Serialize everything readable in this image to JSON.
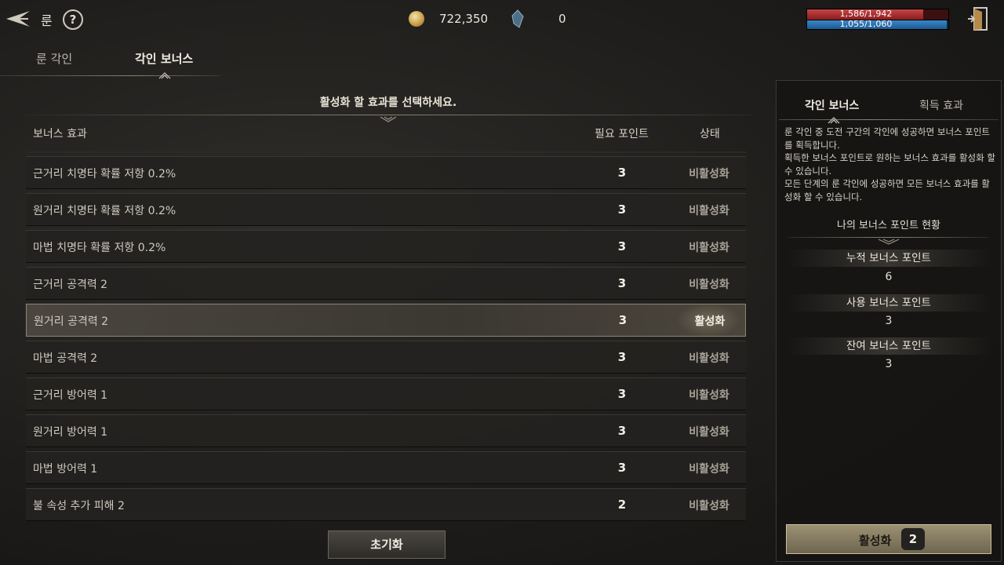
{
  "topbar": {
    "title": "룬",
    "help": "?",
    "gold": "722,350",
    "gems": "0",
    "hp": "1,586/1,942",
    "mp": "1,055/1,060",
    "hp_fraction": 0.82,
    "mp_fraction": 0.99
  },
  "tabs": [
    "룬 각인",
    "각인 보너스"
  ],
  "main": {
    "instruction": "활성화 할 효과를 선택하세요.",
    "headers": {
      "bonus": "보너스 효과",
      "points": "필요 포인트",
      "state": "상태"
    },
    "rows": [
      {
        "name": "근거리 치명타 확률 저항 0.2%",
        "points": "3",
        "state": "비활성화",
        "active": false
      },
      {
        "name": "원거리 치명타 확률 저항 0.2%",
        "points": "3",
        "state": "비활성화",
        "active": false
      },
      {
        "name": "마법 치명타 확률 저항 0.2%",
        "points": "3",
        "state": "비활성화",
        "active": false
      },
      {
        "name": "근거리 공격력 2",
        "points": "3",
        "state": "비활성화",
        "active": false
      },
      {
        "name": "원거리 공격력 2",
        "points": "3",
        "state": "활성화",
        "active": true
      },
      {
        "name": "마법 공격력 2",
        "points": "3",
        "state": "비활성화",
        "active": false
      },
      {
        "name": "근거리 방어력 1",
        "points": "3",
        "state": "비활성화",
        "active": false
      },
      {
        "name": "원거리 방어력 1",
        "points": "3",
        "state": "비활성화",
        "active": false
      },
      {
        "name": "마법 방어력 1",
        "points": "3",
        "state": "비활성화",
        "active": false
      },
      {
        "name": "불 속성 추가 피해 2",
        "points": "2",
        "state": "비활성화",
        "active": false
      }
    ],
    "reset_label": "초기화"
  },
  "side": {
    "tabs": [
      "각인 보너스",
      "획득 효과"
    ],
    "description": [
      "룬 각인 중 도전 구간의 각인에 성공하면 보너스 포인트를 획득합니다.",
      "획득한 보너스 포인트로 원하는 보너스 효과를 활성화 할 수 있습니다.",
      "모든 단계의 룬 각인에 성공하면 모든 보너스 효과를 활성화 할 수 있습니다."
    ],
    "status_title": "나의 보너스 포인트 현황",
    "stats": [
      {
        "label": "누적 보너스 포인트",
        "value": "6"
      },
      {
        "label": "사용 보너스 포인트",
        "value": "3"
      },
      {
        "label": "잔여 보너스 포인트",
        "value": "3"
      }
    ],
    "activate_label": "활성화",
    "activate_count": "2"
  }
}
